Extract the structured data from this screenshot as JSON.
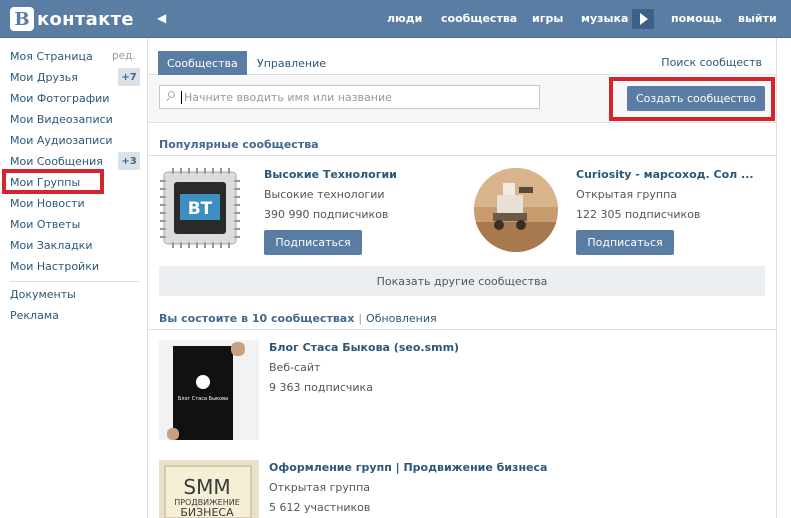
{
  "header": {
    "logo_letter": "B",
    "logo_text": "контакте",
    "nav": [
      "люди",
      "сообщества",
      "игры",
      "музыка",
      "помощь",
      "выйти"
    ]
  },
  "sidebar": {
    "items": [
      {
        "label": "Моя Страница"
      },
      {
        "label": "Мои Друзья",
        "badge": "+7"
      },
      {
        "label": "Мои Фотографии"
      },
      {
        "label": "Мои Видеозаписи"
      },
      {
        "label": "Мои Аудиозаписи"
      },
      {
        "label": "Мои Сообщения",
        "badge": "+3"
      },
      {
        "label": "Мои Группы"
      },
      {
        "label": "Мои Новости"
      },
      {
        "label": "Мои Ответы"
      },
      {
        "label": "Мои Закладки"
      },
      {
        "label": "Мои Настройки"
      }
    ],
    "edit_label": "ред.",
    "extra": [
      "Документы",
      "Реклама"
    ]
  },
  "tabs": {
    "active": "Сообщества",
    "manage": "Управление",
    "search_link": "Поиск сообществ"
  },
  "search": {
    "placeholder": "Начните вводить имя или название",
    "create_button": "Создать сообщество"
  },
  "popular": {
    "title": "Популярные сообщества",
    "cards": [
      {
        "name": "Высокие Технологии",
        "subtitle": "Высокие технологии",
        "subscribers": "390 990 подписчиков",
        "button": "Подписаться",
        "logo_text": "BT"
      },
      {
        "name": "Curiosity - марсоход. Сол ...",
        "subtitle": "Открытая группа",
        "subscribers": "122 305 подписчиков",
        "button": "Подписаться"
      }
    ],
    "more_label": "Показать другие сообщества"
  },
  "my_groups": {
    "title": "Вы состоите в 10 сообществах",
    "separator": "|",
    "updates_link": "Обновления",
    "groups": [
      {
        "name": "Блог Стаса Быкова (seo.smm)",
        "type": "Веб-сайт",
        "count": "9 363 подписчика",
        "poster_text": "Блог Стаса Быкова"
      },
      {
        "name": "Оформление групп | Продвижение бизнеса",
        "type": "Открытая группа",
        "count": "5 612 участников",
        "poster_line1": "SMM",
        "poster_line2": "ПРОДВИЖЕНИЕ",
        "poster_line3": "БИЗНЕСА"
      }
    ]
  },
  "colors": {
    "header_bg": "#597da3",
    "link": "#2b587a",
    "highlight_red": "#d6242c"
  }
}
